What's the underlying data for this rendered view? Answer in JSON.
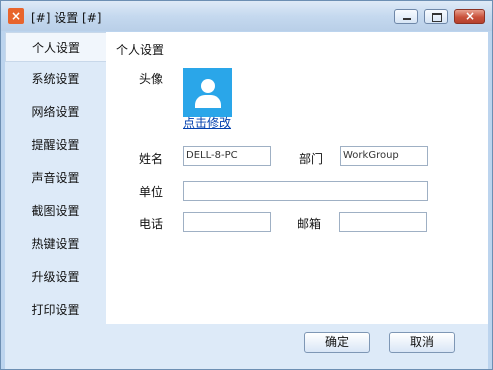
{
  "window": {
    "title": "[#] 设置 [#]",
    "app_icon": "app-icon"
  },
  "sidebar": {
    "items": [
      "个人设置",
      "系统设置",
      "网络设置",
      "提醒设置",
      "声音设置",
      "截图设置",
      "热键设置",
      "升级设置",
      "打印设置"
    ]
  },
  "content": {
    "heading": "个人设置",
    "avatar_label": "头像",
    "avatar_link": "点击修改",
    "name_label": "姓名",
    "name_value": "DELL-8-PC",
    "dept_label": "部门",
    "dept_value": "WorkGroup",
    "unit_label": "单位",
    "unit_value": "",
    "phone_label": "电话",
    "phone_value": "",
    "email_label": "邮箱",
    "email_value": ""
  },
  "footer": {
    "ok": "确定",
    "cancel": "取消"
  },
  "colors": {
    "accent": "#2aa6e9",
    "sidebar": "#ddeaf8"
  }
}
